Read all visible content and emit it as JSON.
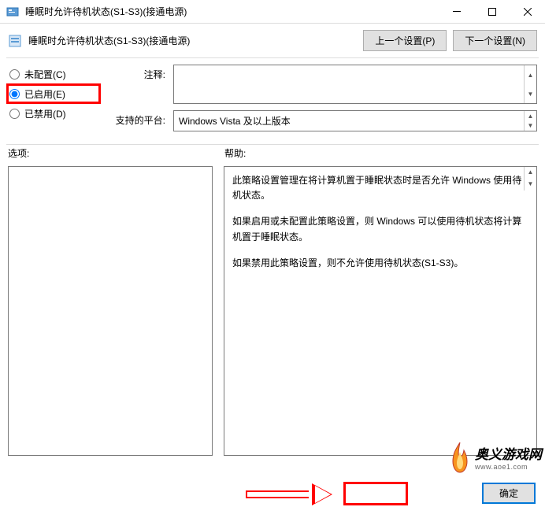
{
  "window": {
    "title": "睡眠时允许待机状态(S1-S3)(接通电源)"
  },
  "header": {
    "policy_title": "睡眠时允许待机状态(S1-S3)(接通电源)",
    "prev_btn": "上一个设置(P)",
    "next_btn": "下一个设置(N)"
  },
  "radios": {
    "not_configured": "未配置(C)",
    "enabled": "已启用(E)",
    "disabled": "已禁用(D)",
    "selected": "enabled"
  },
  "fields": {
    "comment_label": "注释:",
    "comment_value": "",
    "platform_label": "支持的平台:",
    "platform_value": "Windows Vista 及以上版本"
  },
  "sections": {
    "options_label": "选项:",
    "help_label": "帮助:"
  },
  "help": {
    "p1": "此策略设置管理在将计算机置于睡眠状态时是否允许 Windows 使用待机状态。",
    "p2": "如果启用或未配置此策略设置，则 Windows 可以使用待机状态将计算机置于睡眠状态。",
    "p3": "如果禁用此策略设置，则不允许使用待机状态(S1-S3)。"
  },
  "footer": {
    "ok": "确定"
  },
  "watermark": {
    "name": "奥义游戏网",
    "url": "www.aoe1.com"
  }
}
